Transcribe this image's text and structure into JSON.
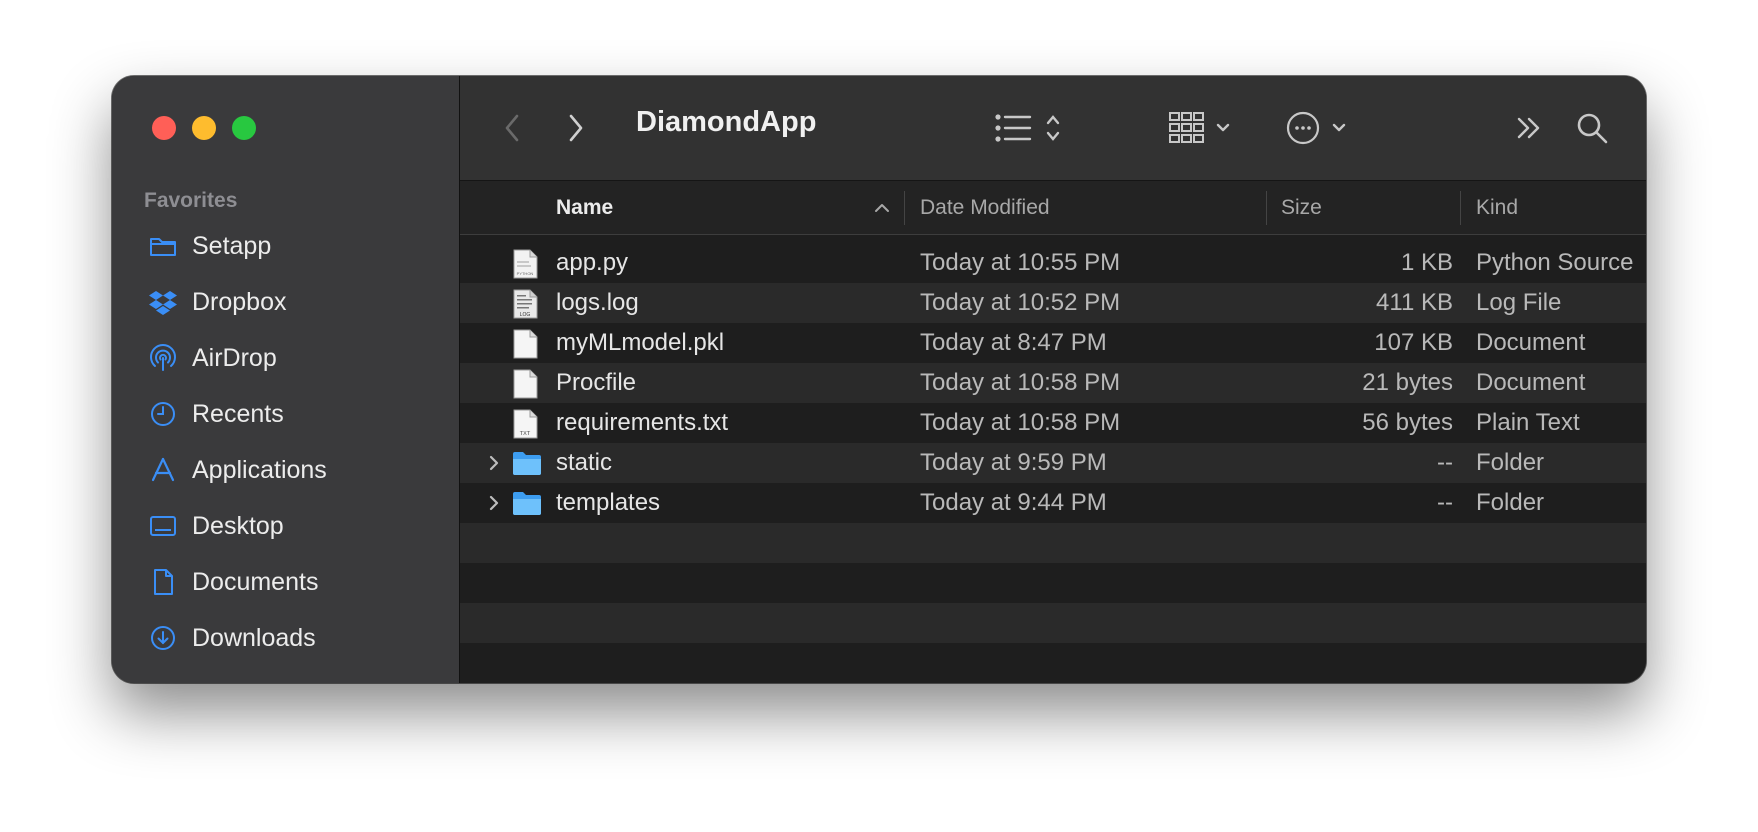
{
  "window": {
    "title": "DiamondApp"
  },
  "sidebar": {
    "section_title": "Favorites",
    "items": [
      {
        "label": "Setapp",
        "icon": "folder-icon"
      },
      {
        "label": "Dropbox",
        "icon": "dropbox-icon"
      },
      {
        "label": "AirDrop",
        "icon": "airdrop-icon"
      },
      {
        "label": "Recents",
        "icon": "clock-icon"
      },
      {
        "label": "Applications",
        "icon": "applications-icon"
      },
      {
        "label": "Desktop",
        "icon": "desktop-icon"
      },
      {
        "label": "Documents",
        "icon": "document-icon"
      },
      {
        "label": "Downloads",
        "icon": "download-icon"
      }
    ]
  },
  "columns": {
    "name": "Name",
    "date": "Date Modified",
    "size": "Size",
    "kind": "Kind"
  },
  "files": [
    {
      "name": "app.py",
      "date": "Today at 10:55 PM",
      "size": "1 KB",
      "kind": "Python Source",
      "icon": "python-file-icon",
      "folder": false
    },
    {
      "name": "logs.log",
      "date": "Today at 10:52 PM",
      "size": "411 KB",
      "kind": "Log File",
      "icon": "log-file-icon",
      "folder": false
    },
    {
      "name": "myMLmodel.pkl",
      "date": "Today at 8:47 PM",
      "size": "107 KB",
      "kind": "Document",
      "icon": "document-file-icon",
      "folder": false
    },
    {
      "name": "Procfile",
      "date": "Today at 10:58 PM",
      "size": "21 bytes",
      "kind": "Document",
      "icon": "document-file-icon",
      "folder": false
    },
    {
      "name": "requirements.txt",
      "date": "Today at 10:58 PM",
      "size": "56 bytes",
      "kind": "Plain Text",
      "icon": "text-file-icon",
      "folder": false
    },
    {
      "name": "static",
      "date": "Today at 9:59 PM",
      "size": "--",
      "kind": "Folder",
      "icon": "folder-icon",
      "folder": true
    },
    {
      "name": "templates",
      "date": "Today at 9:44 PM",
      "size": "--",
      "kind": "Folder",
      "icon": "folder-icon",
      "folder": true
    }
  ],
  "colors": {
    "accent": "#3a8ef6",
    "close": "#ff5f57",
    "minimize": "#febc2e",
    "zoom": "#28c840"
  }
}
